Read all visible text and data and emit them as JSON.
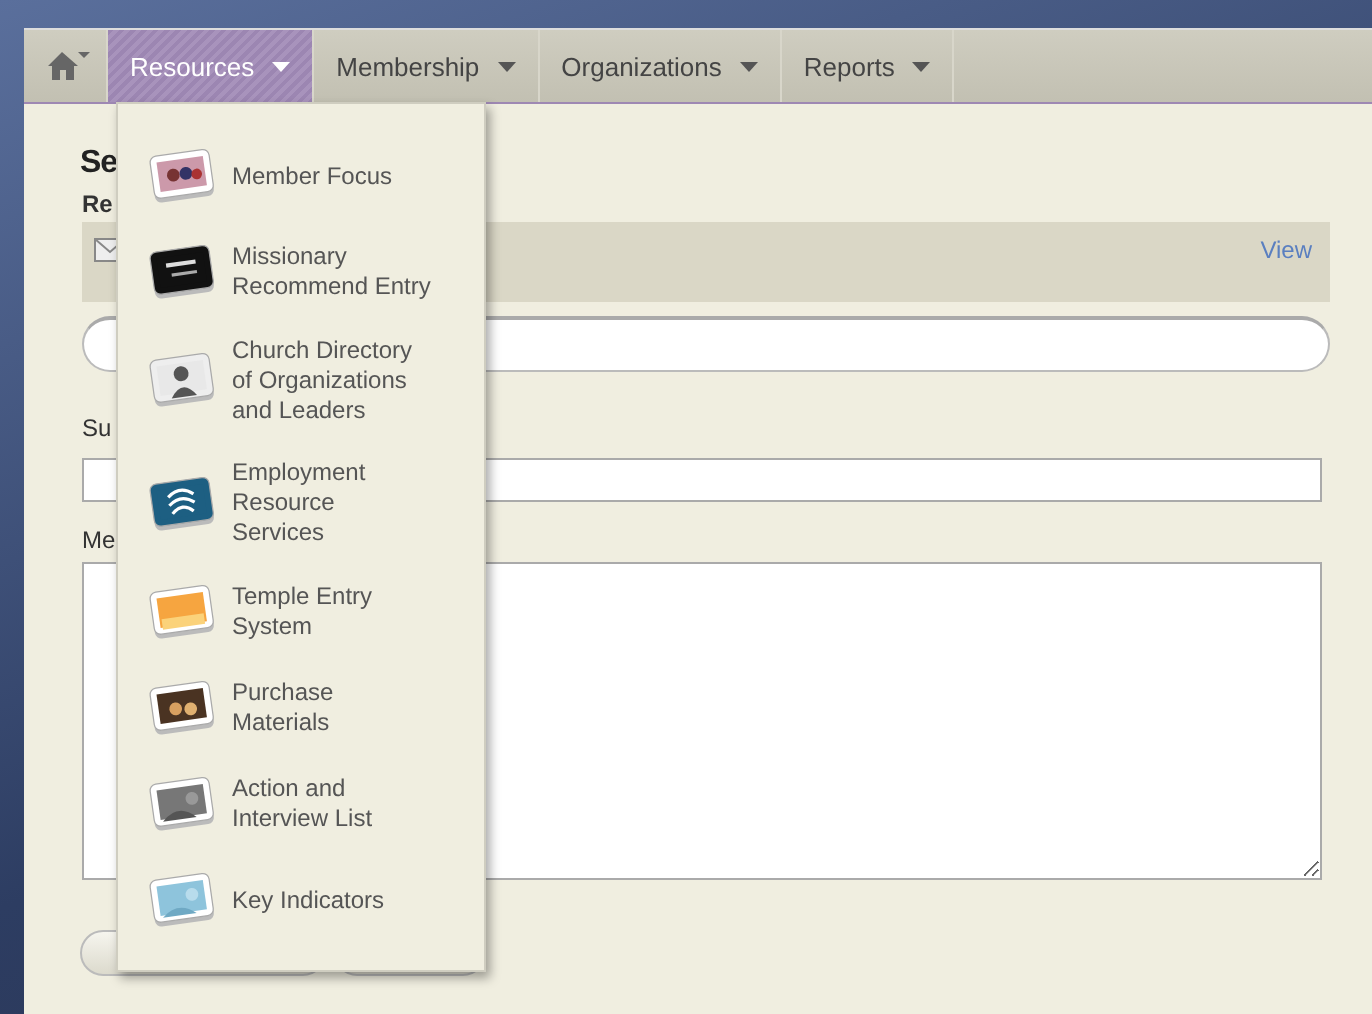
{
  "nav": {
    "menus": [
      {
        "label": "Resources",
        "selected": true
      },
      {
        "label": "Membership",
        "selected": false
      },
      {
        "label": "Organizations",
        "selected": false
      },
      {
        "label": "Reports",
        "selected": false
      }
    ]
  },
  "dropdown": {
    "items": [
      {
        "label": "Member Focus"
      },
      {
        "label": "Missionary\nRecommend Entry"
      },
      {
        "label": "Church Directory\nof Organizations\nand Leaders"
      },
      {
        "label": "Employment\nResource\nServices"
      },
      {
        "label": "Temple Entry\nSystem"
      },
      {
        "label": "Purchase\nMaterials"
      },
      {
        "label": "Action and\nInterview List"
      },
      {
        "label": "Key Indicators"
      }
    ]
  },
  "form": {
    "heading": "Se",
    "recipients_label": "Re",
    "view_link": "View",
    "subject_label": "Su",
    "message_label": "Me"
  }
}
